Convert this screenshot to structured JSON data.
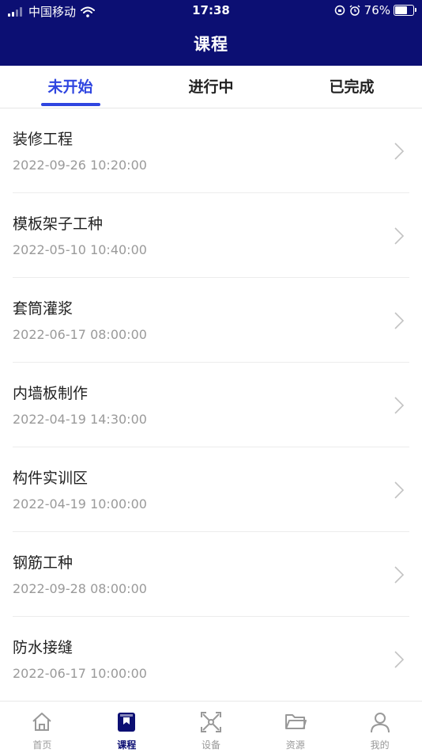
{
  "status_bar": {
    "carrier": "中国移动",
    "time": "17:38",
    "battery": "76%",
    "battery_level": 0.76
  },
  "header": {
    "title": "课程"
  },
  "tabs": [
    {
      "label": "未开始"
    },
    {
      "label": "进行中"
    },
    {
      "label": "已完成"
    }
  ],
  "active_tab": 0,
  "courses": [
    {
      "name": "装修工程",
      "date": "2022-09-26 10:20:00"
    },
    {
      "name": "模板架子工种",
      "date": "2022-05-10 10:40:00"
    },
    {
      "name": "套筒灌浆",
      "date": "2022-06-17 08:00:00"
    },
    {
      "name": "内墙板制作",
      "date": "2022-04-19 14:30:00"
    },
    {
      "name": "构件实训区",
      "date": "2022-04-19 10:00:00"
    },
    {
      "name": "钢筋工种",
      "date": "2022-09-28 08:00:00"
    },
    {
      "name": "防水接缝",
      "date": "2022-06-17 10:00:00"
    }
  ],
  "bottom_nav": [
    {
      "label": "首页",
      "icon": "home-icon"
    },
    {
      "label": "课程",
      "icon": "course-book-icon"
    },
    {
      "label": "设备",
      "icon": "device-icon"
    },
    {
      "label": "资源",
      "icon": "folder-icon"
    },
    {
      "label": "我的",
      "icon": "user-icon"
    }
  ],
  "colors": {
    "header_bg": "#0c0f73",
    "accent": "#2f45e0",
    "inactive": "#999999"
  }
}
